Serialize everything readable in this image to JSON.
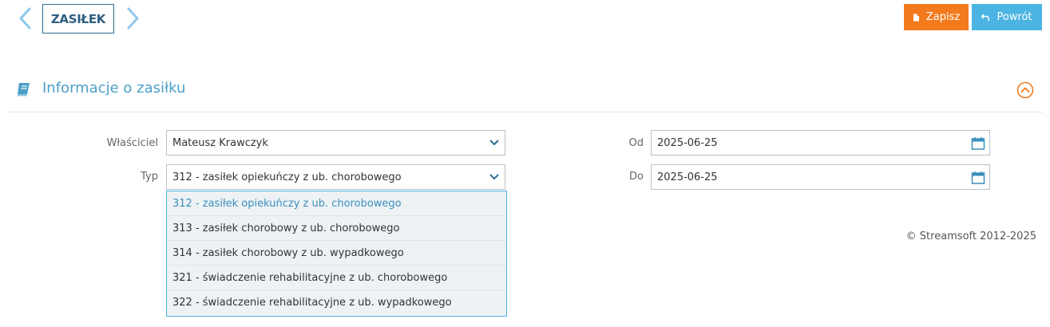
{
  "header": {
    "title": "ZASIŁEK",
    "save_label": "Zapisz",
    "back_label": "Powrót"
  },
  "section": {
    "title": "Informacje o zasiłku"
  },
  "form": {
    "owner_label": "Właściciel",
    "owner_value": "Mateusz Krawczyk",
    "type_label": "Typ",
    "type_value": "312 - zasiłek opiekuńczy z ub. chorobowego",
    "from_label": "Od",
    "from_value": "2025-06-25",
    "to_label": "Do",
    "to_value": "2025-06-25"
  },
  "dropdown": {
    "options": [
      "312 - zasiłek opiekuńczy z ub. chorobowego",
      "313 - zasiłek chorobowy z ub. chorobowego",
      "314 - zasiłek chorobowy z ub. wypadkowego",
      "321 - świadczenie rehabilitacyjne z ub. chorobowego",
      "322 - świadczenie rehabilitacyjne z ub. wypadkowego"
    ]
  },
  "footer": {
    "copyright": "© Streamsoft 2012-2025"
  },
  "colors": {
    "accent_blue": "#4cb4e2",
    "save_orange": "#f37b1d",
    "title_blue": "#2e5f82"
  }
}
